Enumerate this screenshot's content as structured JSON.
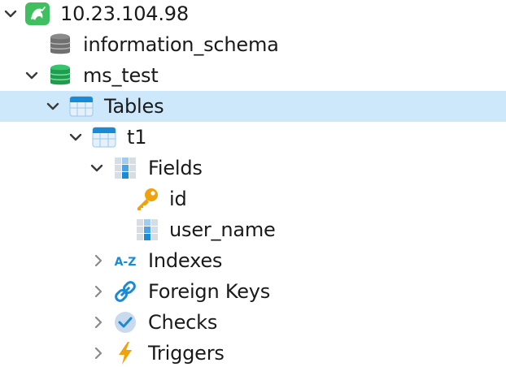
{
  "tree": {
    "connection": {
      "label": "10.23.104.98",
      "expanded": true,
      "icon": "mysql-dolphin-icon"
    },
    "databases": [
      {
        "label": "information_schema",
        "expanded": false,
        "icon": "database-gray-icon"
      },
      {
        "label": "ms_test",
        "expanded": true,
        "icon": "database-green-icon"
      }
    ],
    "tables_folder": {
      "label": "Tables",
      "expanded": true,
      "selected": true,
      "icon": "tables-folder-icon"
    },
    "table": {
      "label": "t1",
      "expanded": true,
      "icon": "table-icon"
    },
    "fields_folder": {
      "label": "Fields",
      "expanded": true,
      "icon": "fields-icon"
    },
    "fields": [
      {
        "label": "id",
        "icon": "primary-key-icon"
      },
      {
        "label": "user_name",
        "icon": "field-column-icon"
      }
    ],
    "indexes": {
      "label": "Indexes",
      "expanded": false,
      "icon_text": "A-Z",
      "icon": "indexes-icon"
    },
    "foreign_keys": {
      "label": "Foreign Keys",
      "expanded": false,
      "icon": "link-icon"
    },
    "checks": {
      "label": "Checks",
      "expanded": false,
      "icon": "check-circle-icon"
    },
    "triggers": {
      "label": "Triggers",
      "expanded": false,
      "icon": "lightning-icon"
    }
  },
  "colors": {
    "selection": "#cde8fb",
    "mysql_green": "#3fbf5f",
    "accent_blue": "#1a8ad4",
    "key_orange": "#f0a20c"
  }
}
